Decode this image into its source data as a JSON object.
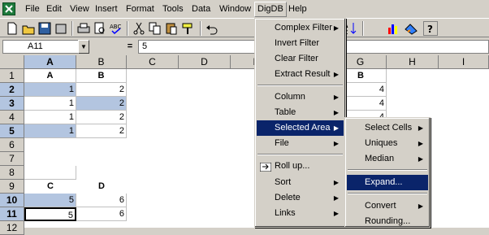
{
  "menubar": {
    "items": [
      "File",
      "Edit",
      "View",
      "Insert",
      "Format",
      "Tools",
      "Data",
      "Window",
      "DigDB",
      "Help"
    ]
  },
  "formula": {
    "name_box": "A11",
    "equals": "=",
    "value": "5"
  },
  "toolbar": {
    "font_size": "8"
  },
  "grid": {
    "columns": [
      "A",
      "B",
      "C",
      "D",
      "E",
      "F",
      "G",
      "H",
      "I"
    ],
    "rows": [
      "1",
      "2",
      "3",
      "4",
      "5",
      "6",
      "7",
      "8",
      "9",
      "10",
      "11",
      "12"
    ],
    "cells": {
      "A1": "A",
      "B1": "B",
      "G1": "B",
      "A2": "1",
      "B2": "2",
      "G2": "4",
      "A3": "1",
      "B3": "2",
      "G3": "4",
      "A4": "1",
      "B4": "2",
      "G4": "4",
      "A5": "1",
      "B5": "2",
      "A9": "C",
      "B9": "D",
      "A10": "5",
      "B10": "6",
      "A11": "5",
      "B11": "6"
    }
  },
  "digdb_menu": {
    "items": [
      "Complex Filter",
      "Invert Filter",
      "Clear Filter",
      "Extract Result",
      "Column",
      "Table",
      "Selected Area",
      "File",
      "Roll up...",
      "Sort",
      "Delete",
      "Links"
    ]
  },
  "selected_area_menu": {
    "items": [
      "Select Cells",
      "Uniques",
      "Median",
      "Expand...",
      "Convert",
      "Rounding..."
    ]
  },
  "colors": {
    "highlight": "#0a246a",
    "selection": "#b3c5e0"
  }
}
